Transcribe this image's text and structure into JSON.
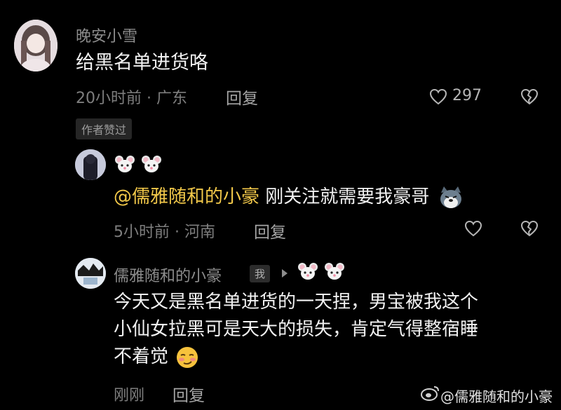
{
  "comment1": {
    "username": "晚安小雪",
    "text": "给黑名单进货咯",
    "time_location": "20小时前 · 广东",
    "reply_label": "回复",
    "like_count": "297",
    "badge": "作者赞过"
  },
  "reply1": {
    "username_emoji": [
      "mouse-face",
      "mouse-face"
    ],
    "mention": "@儒雅随和的小豪",
    "text": " 刚关注就需要我豪哥",
    "trailing_emoji": "doge-face",
    "time_location": "5小时前 · 河南",
    "reply_label": "回复"
  },
  "reply2": {
    "username": "儒雅随和的小豪",
    "me_badge": "我",
    "reply_to_emoji": [
      "mouse-face",
      "mouse-face"
    ],
    "text_lines": [
      "今天又是黑名单进货的一天捏，男宝被我这个",
      "小仙女拉黑可是天大的损失，肯定气得整宿睡",
      "不着觉"
    ],
    "trailing_emoji": "smirk-face",
    "time": "刚刚",
    "reply_label": "回复"
  },
  "watermark": {
    "text": "@儒雅随和的小豪"
  },
  "colors": {
    "background": "#000000",
    "mention": "#f3c94a",
    "meta_text": "#7e7e7e",
    "name_text": "#8d8d8d"
  }
}
